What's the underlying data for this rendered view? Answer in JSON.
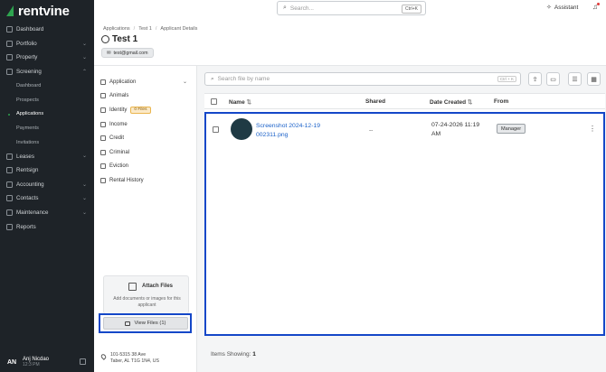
{
  "brand": {
    "name": "rentvine",
    "accent": "#2ea44f"
  },
  "sidebar": {
    "items": [
      {
        "label": "Dashboard",
        "icon": "dashboard-icon",
        "chevron": ""
      },
      {
        "label": "Portfolio",
        "icon": "portfolio-icon",
        "chevron": "⌄"
      },
      {
        "label": "Property",
        "icon": "property-icon",
        "chevron": "⌄"
      },
      {
        "label": "Screening",
        "icon": "screening-icon",
        "chevron": "⌃"
      }
    ],
    "screening_sub": [
      "Dashboard",
      "Prospects",
      "Applications",
      "Payments",
      "Invitations"
    ],
    "items_after": [
      {
        "label": "Leases",
        "icon": "leases-icon",
        "chevron": "⌄"
      },
      {
        "label": "Rentsign",
        "icon": "rentsign-icon",
        "chevron": ""
      },
      {
        "label": "Accounting",
        "icon": "accounting-icon",
        "chevron": "⌄"
      },
      {
        "label": "Contacts",
        "icon": "contacts-icon",
        "chevron": "⌄"
      },
      {
        "label": "Maintenance",
        "icon": "maintenance-icon",
        "chevron": "⌄"
      },
      {
        "label": "Reports",
        "icon": "reports-icon",
        "chevron": ""
      }
    ],
    "user": {
      "initials": "AN",
      "name": "Anj Nicdao",
      "time": "12:3 PM"
    }
  },
  "topbar": {
    "search_placeholder": "Search...",
    "shortcut": "Ctrl+K",
    "assistant": "Assistant"
  },
  "header": {
    "breadcrumb": [
      "Applications",
      "Test 1",
      "Applicant Details"
    ],
    "title": "Test 1",
    "email": "test@gmail.com"
  },
  "menu": {
    "items": [
      "Application",
      "Animals",
      "Identity",
      "Income",
      "Credit",
      "Criminal",
      "Eviction",
      "Rental History"
    ],
    "identity_badge": "0 Files",
    "attach_title": "Attach Files",
    "attach_subtitle": "Add documents or images for this applicant",
    "view_files": "View Files (1)",
    "address_line1": "101-5315 38 Ave",
    "address_line2": "Taber, AL T1G 1N4, US"
  },
  "files": {
    "search_placeholder": "Search file by name",
    "search_shortcut": "Ctrl + K",
    "columns": [
      "Name",
      "Shared",
      "Date Created",
      "From"
    ],
    "rows": [
      {
        "name": "Screenshot 2024-12-19 002311.png",
        "shared": "--",
        "date": "07-24-2026 11:19 AM",
        "from": "Manager"
      }
    ],
    "footer_label": "Items Showing:",
    "footer_count": "1"
  }
}
